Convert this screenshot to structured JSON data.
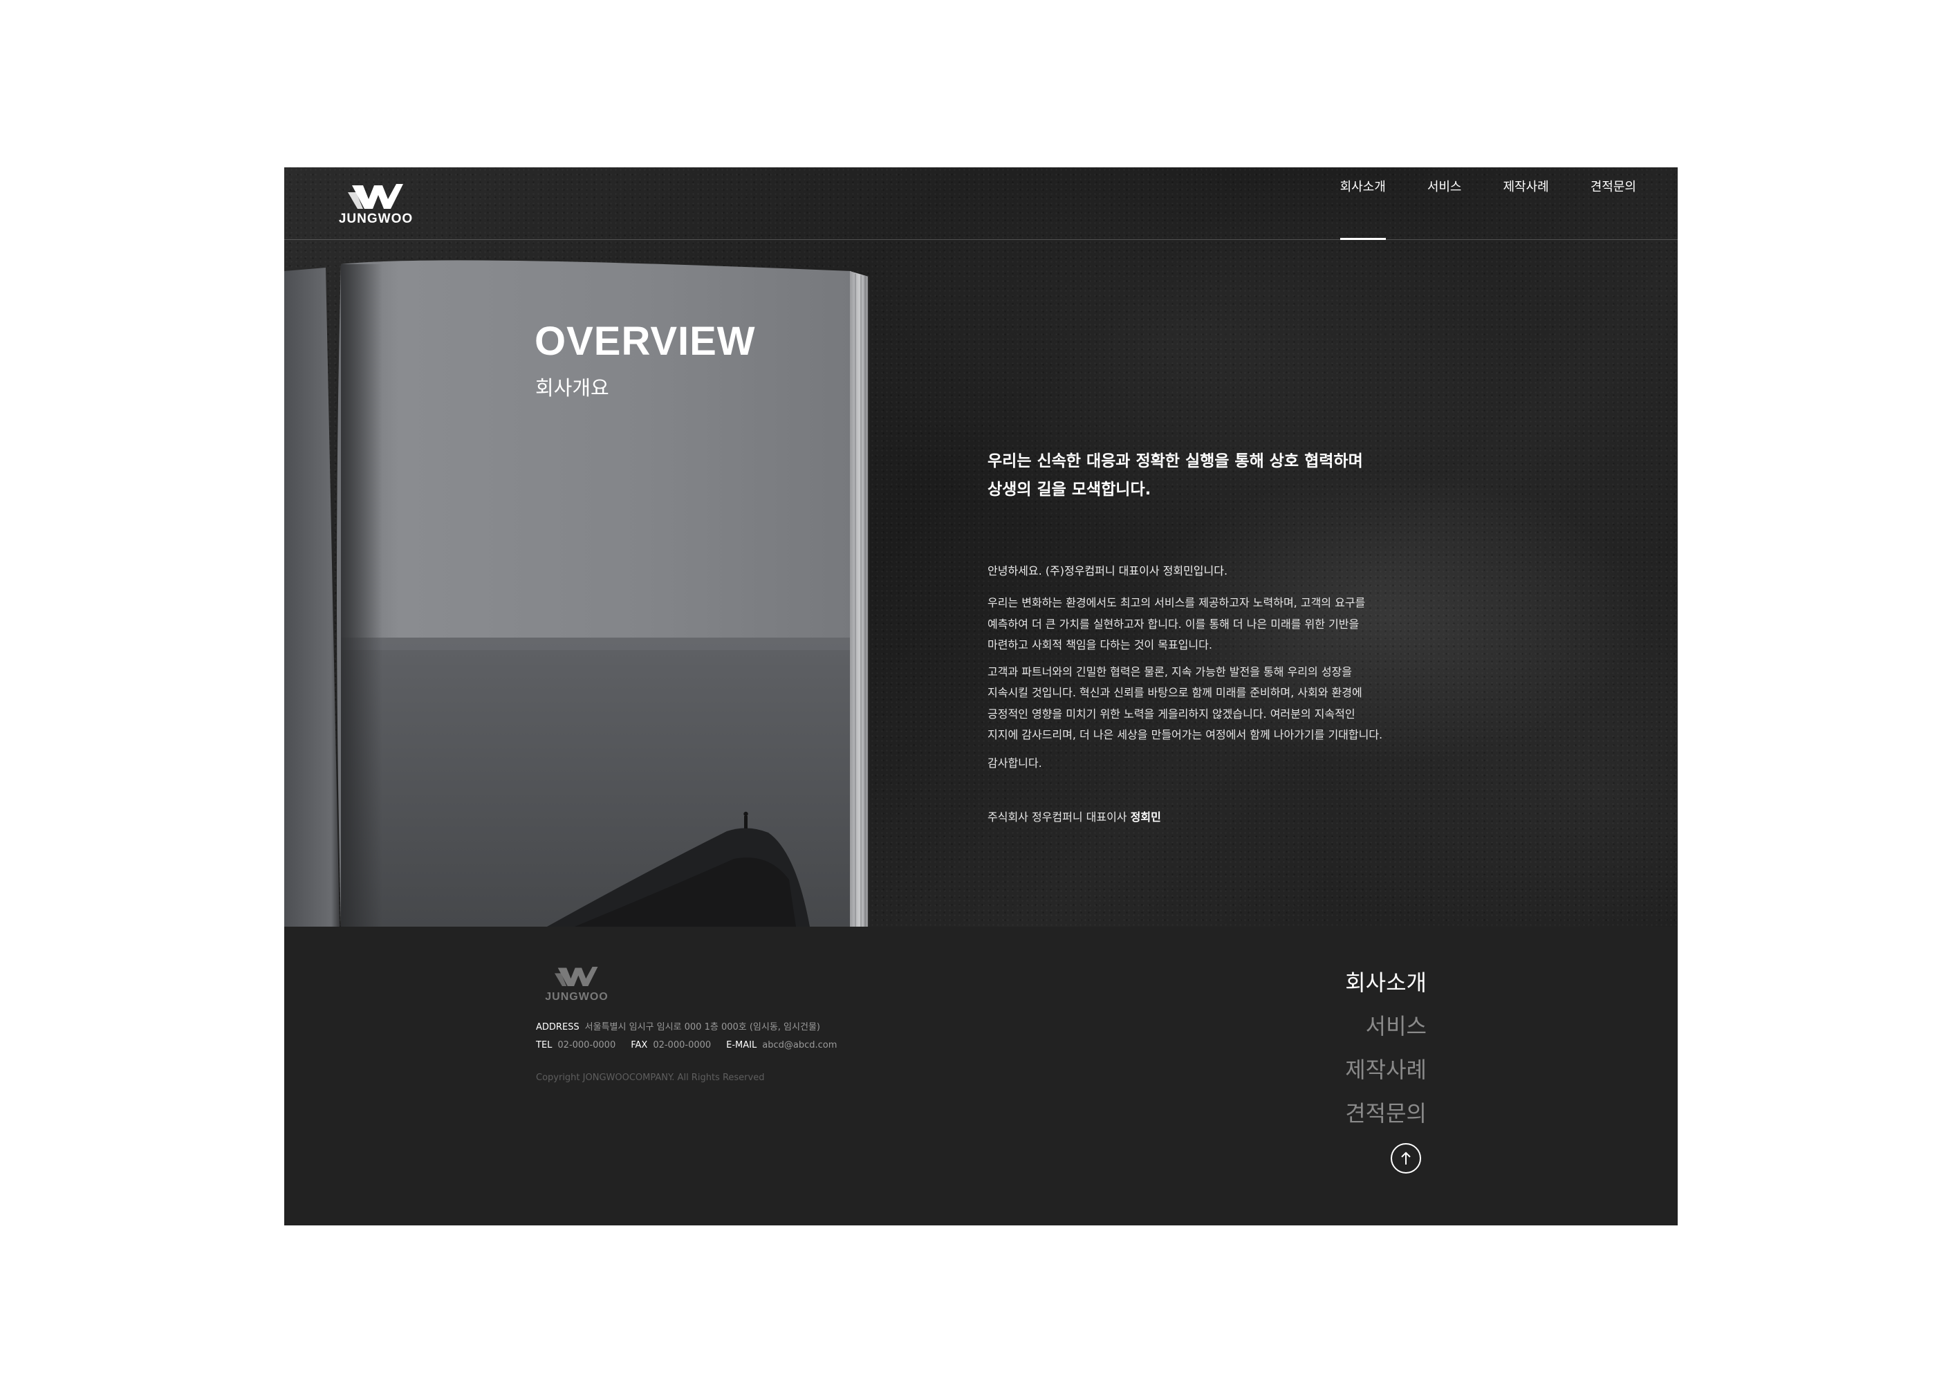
{
  "brand": {
    "name": "JUNGWOO"
  },
  "nav": {
    "items": [
      "회사소개",
      "서비스",
      "제작사례",
      "견적문의"
    ],
    "active_index": 0
  },
  "hero": {
    "title": "OVERVIEW",
    "subtitle": "회사개요"
  },
  "message": {
    "headline_line1": "우리는 신속한 대응과 정확한 실행을 통해 상호 협력하며",
    "headline_line2": "상생의 길을 모색합니다.",
    "greeting": "안녕하세요. (주)정우컴퍼니 대표이사 정회민입니다.",
    "para1": [
      "우리는 변화하는 환경에서도 최고의 서비스를 제공하고자 노력하며, 고객의 요구를",
      "예측하여 더 큰 가치를 실현하고자 합니다. 이를 통해 더 나은 미래를 위한 기반을",
      "마련하고 사회적 책임을 다하는 것이 목표입니다."
    ],
    "para2": [
      "고객과 파트너와의 긴밀한 협력은 물론, 지속 가능한 발전을 통해 우리의 성장을",
      "지속시킬 것입니다. 혁신과 신뢰를 바탕으로 함께 미래를 준비하며, 사회와 환경에",
      "긍정적인 영향을 미치기 위한 노력을 게을리하지 않겠습니다. 여러분의 지속적인",
      "지지에 감사드리며, 더 나은 세상을 만들어가는 여정에서 함께 나아가기를 기대합니다."
    ],
    "thanks": "감사합니다.",
    "signature_prefix": "주식회사 정우컴퍼니 대표이사",
    "signature_name": "정회민"
  },
  "footer": {
    "address_label": "ADDRESS",
    "address": "서울특별시 임시구 임시로 000 1층 000호 (임시동, 임시건물)",
    "tel_label": "TEL",
    "tel": "02-000-0000",
    "fax_label": "FAX",
    "fax": "02-000-0000",
    "email_label": "E-MAIL",
    "email": "abcd@abcd.com",
    "copyright": "Copyright JONGWOOCOMPANY. All Rights Reserved",
    "nav": [
      "회사소개",
      "서비스",
      "제작사례",
      "견적문의"
    ]
  },
  "icons": {
    "logo": "jungwoo-w-mark",
    "top_button": "arrow-up-icon"
  },
  "colors": {
    "frame_bg": "#222222",
    "text": "#ffffff",
    "muted": "#8a8a8a",
    "page_bg": "#ffffff"
  }
}
